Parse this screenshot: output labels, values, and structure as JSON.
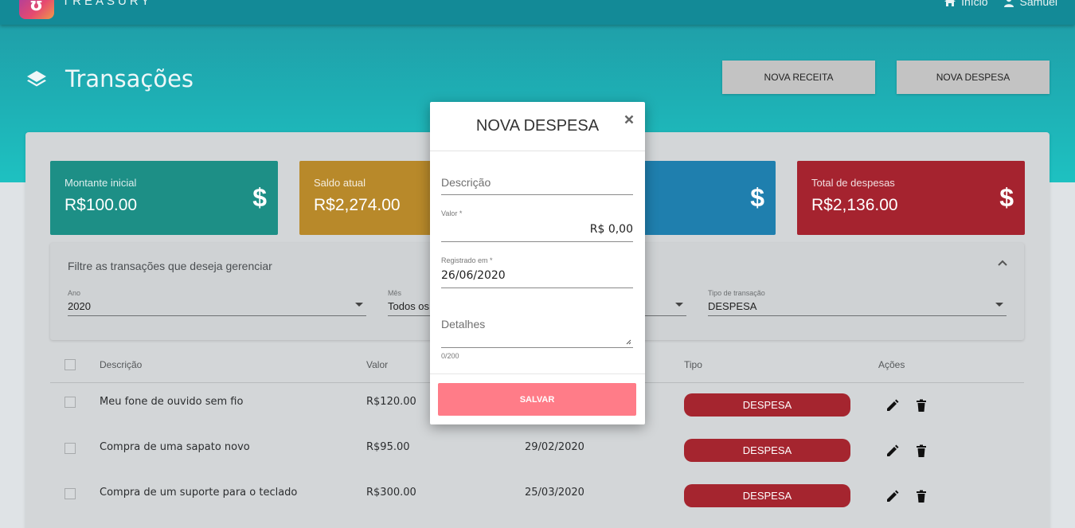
{
  "header": {
    "brand": "TREASURY",
    "nav": [
      {
        "label": "Início",
        "icon": "home-icon"
      },
      {
        "label": "Samuel",
        "icon": "user-icon"
      }
    ]
  },
  "page": {
    "title": "Transações",
    "title_icon": "layers-icon",
    "buttons": {
      "new_income": "NOVA RECEITA",
      "new_expense": "NOVA DESPESA"
    }
  },
  "stats": [
    {
      "label": "Montante inicial",
      "value": "R$100.00",
      "icon": "dollar-icon",
      "color": "#1d8f86"
    },
    {
      "label": "Saldo atual",
      "value": "R$2,274.00",
      "icon": "dollar-icon",
      "color": "#b8892a"
    },
    {
      "label": "",
      "value": "",
      "icon": "dollar-icon",
      "color": "#1f7fae"
    },
    {
      "label": "Total de despesas",
      "value": "R$2,136.00",
      "icon": "dollar-icon",
      "color": "#a5232f"
    }
  ],
  "filter": {
    "title": "Filtre as transações que deseja gerenciar",
    "selects": [
      {
        "label": "Ano",
        "value": "2020"
      },
      {
        "label": "Mês",
        "value": "Todos os"
      },
      {
        "label": "",
        "value": ""
      },
      {
        "label": "Tipo de transação",
        "value": "DESPESA"
      }
    ]
  },
  "table": {
    "headers": {
      "description": "Descrição",
      "value": "Valor",
      "type": "Tipo",
      "actions": "Ações"
    },
    "rows": [
      {
        "description": "Meu fone de ouvido sem fio",
        "value": "R$120.00",
        "date": "",
        "type": "DESPESA"
      },
      {
        "description": "Compra de uma sapato novo",
        "value": "R$95.00",
        "date": "29/02/2020",
        "type": "DESPESA"
      },
      {
        "description": "Compra de um suporte para o teclado",
        "value": "R$300.00",
        "date": "25/03/2020",
        "type": "DESPESA"
      }
    ]
  },
  "modal": {
    "title": "NOVA DESPESA",
    "fields": {
      "description_placeholder": "Descrição",
      "value_label": "Valor *",
      "value": "R$ 0,00",
      "date_label": "Registrado em *",
      "date": "26/06/2020",
      "details_placeholder": "Detalhes",
      "counter": "0/200"
    },
    "save_label": "SALVAR"
  },
  "colors": {
    "accent_teal": "#1ec1c1",
    "expense_red": "#a5252f",
    "save_button": "#ff7c88"
  }
}
